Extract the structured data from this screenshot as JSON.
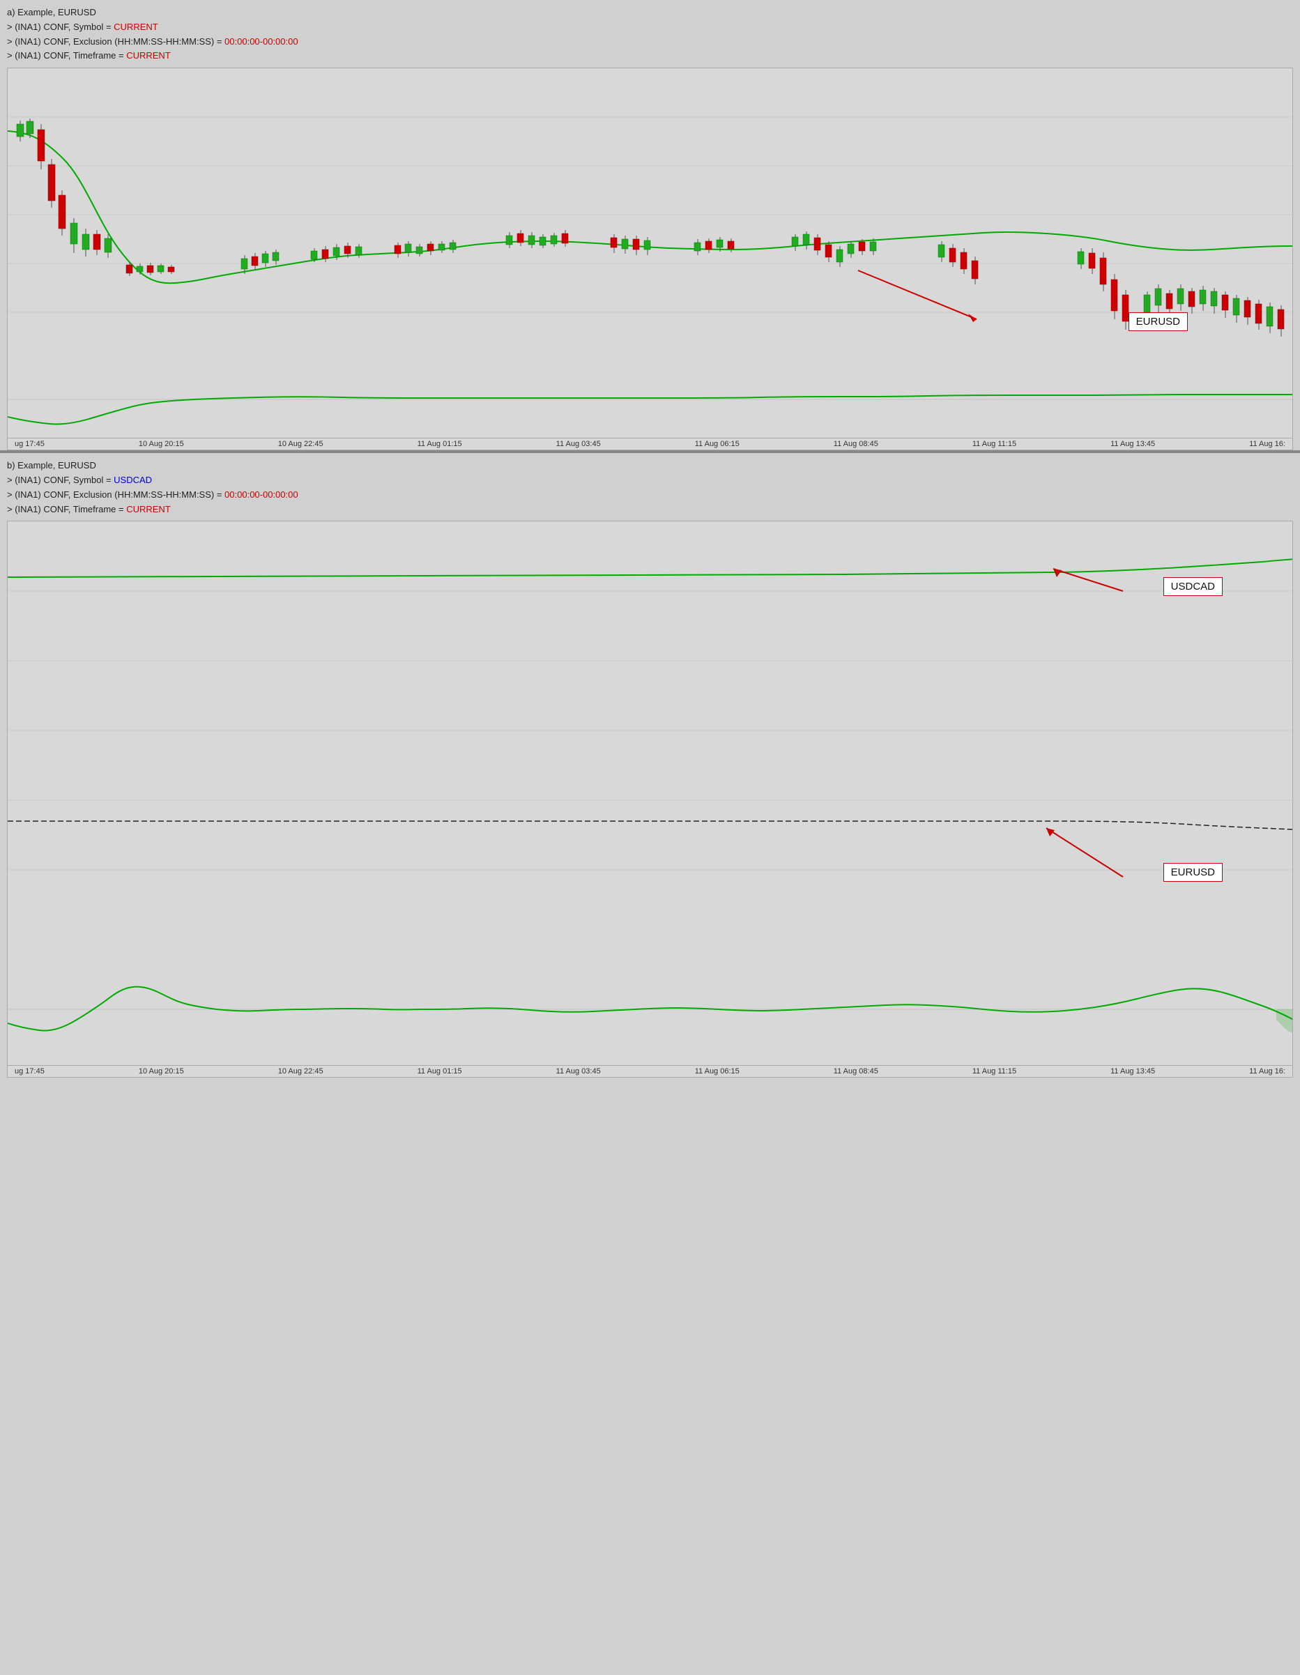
{
  "sectionA": {
    "title": "a) Example, EURUSD",
    "config": [
      {
        "label": "> (INA1) CONF, Symbol = ",
        "value": "CURRENT",
        "valueColor": "red"
      },
      {
        "label": "> (INA1) CONF, Exclusion (HH:MM:SS-HH:MM:SS) = ",
        "value": "00:00:00-00:00:00",
        "valueColor": "red"
      },
      {
        "label": "> (INA1) CONF, Timeframe = ",
        "value": "CURRENT",
        "valueColor": "red"
      }
    ],
    "chartLabel": "EURUSD",
    "timeLabels": [
      "ug 17:45",
      "10 Aug 20:15",
      "10 Aug 22:45",
      "11 Aug 01:15",
      "11 Aug 03:45",
      "11 Aug 06:15",
      "11 Aug 08:45",
      "11 Aug 11:15",
      "11 Aug 13:45",
      "11 Aug 16:"
    ]
  },
  "sectionB": {
    "title": "b) Example, EURUSD",
    "config": [
      {
        "label": "> (INA1) CONF, Symbol = ",
        "value": "USDCAD",
        "valueColor": "blue"
      },
      {
        "label": "> (INA1) CONF, Exclusion (HH:MM:SS-HH:MM:SS) = ",
        "value": "00:00:00-00:00:00",
        "valueColor": "red"
      },
      {
        "label": "> (INA1) CONF, Timeframe = ",
        "value": "CURRENT",
        "valueColor": "red"
      }
    ],
    "chartLabel1": "USDCAD",
    "chartLabel2": "EURUSD",
    "timeLabels": [
      "ug 17:45",
      "10 Aug 20:15",
      "10 Aug 22:45",
      "11 Aug 01:15",
      "11 Aug 03:45",
      "11 Aug 06:15",
      "11 Aug 08:45",
      "11 Aug 11:15",
      "11 Aug 13:45",
      "11 Aug 16:"
    ]
  }
}
